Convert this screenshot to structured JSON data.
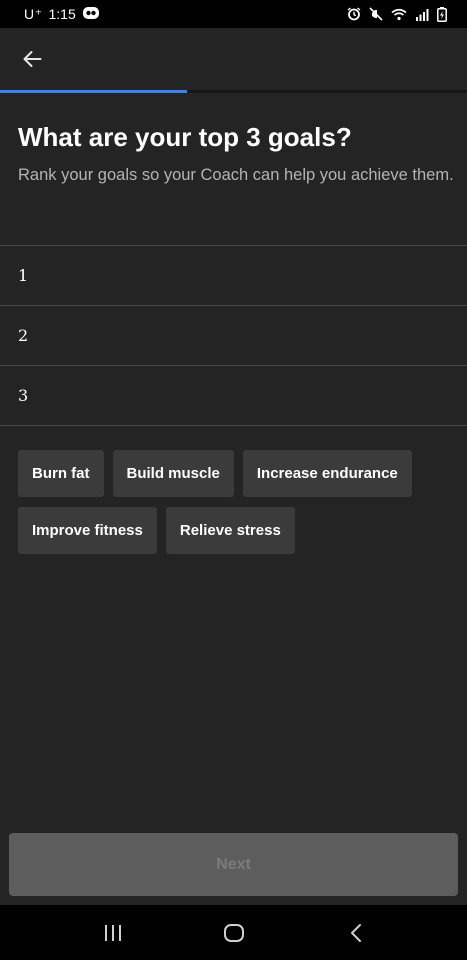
{
  "status_bar": {
    "carrier": "U⁺",
    "time": "1:15",
    "icons": [
      "app-notification-icon",
      "alarm-icon",
      "mute-icon",
      "wifi-icon",
      "signal-icon",
      "battery-icon"
    ]
  },
  "app_bar": {
    "back_icon": "arrow-left-icon"
  },
  "progress": {
    "fraction": 0.4,
    "color": "#3d82f2"
  },
  "header": {
    "title": "What are your top 3 goals?",
    "subtitle": "Rank your goals so your Coach can help you achieve them."
  },
  "ranks": {
    "slots": [
      "1",
      "2",
      "3"
    ]
  },
  "goals": {
    "row1": [
      "Burn fat",
      "Build muscle",
      "Increase endurance"
    ],
    "row2": [
      "Improve fitness",
      "Relieve stress"
    ]
  },
  "footer": {
    "next_label": "Next"
  },
  "nav_bar": {
    "icons": [
      "recent-apps-icon",
      "home-icon",
      "back-icon"
    ]
  }
}
